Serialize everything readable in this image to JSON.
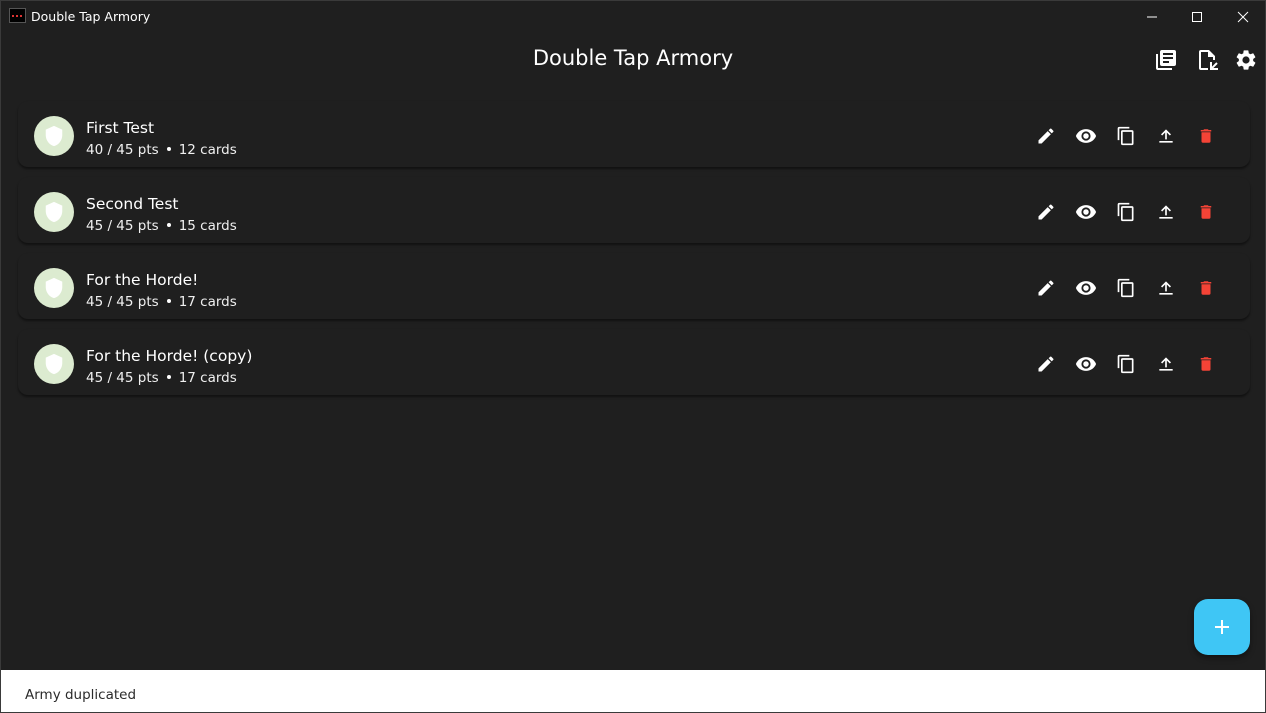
{
  "window": {
    "title": "Double Tap Armory"
  },
  "appbar": {
    "title": "Double Tap Armory",
    "actions": [
      {
        "icon": "library-books-icon"
      },
      {
        "icon": "file-import-icon"
      },
      {
        "icon": "settings-gear-icon"
      }
    ]
  },
  "armies": [
    {
      "name": "First Test",
      "points": "40 / 45 pts",
      "cards": "12 cards"
    },
    {
      "name": "Second Test",
      "points": "45 / 45 pts",
      "cards": "15 cards"
    },
    {
      "name": "For the Horde!",
      "points": "45 / 45 pts",
      "cards": "17 cards"
    },
    {
      "name": "For the Horde! (copy)",
      "points": "45 / 45 pts",
      "cards": "17 cards"
    }
  ],
  "row_actions": [
    "edit-icon",
    "view-eye-icon",
    "copy-icon",
    "export-upload-icon",
    "delete-trash-icon"
  ],
  "fab": {
    "symbol": "+"
  },
  "snackbar": {
    "message": "Army duplicated"
  },
  "colors": {
    "background": "#1f1f1f",
    "avatar": "#dcebd0",
    "delete": "#f44336",
    "fab": "#3fc6f5",
    "snackbar": "#ffffff"
  }
}
